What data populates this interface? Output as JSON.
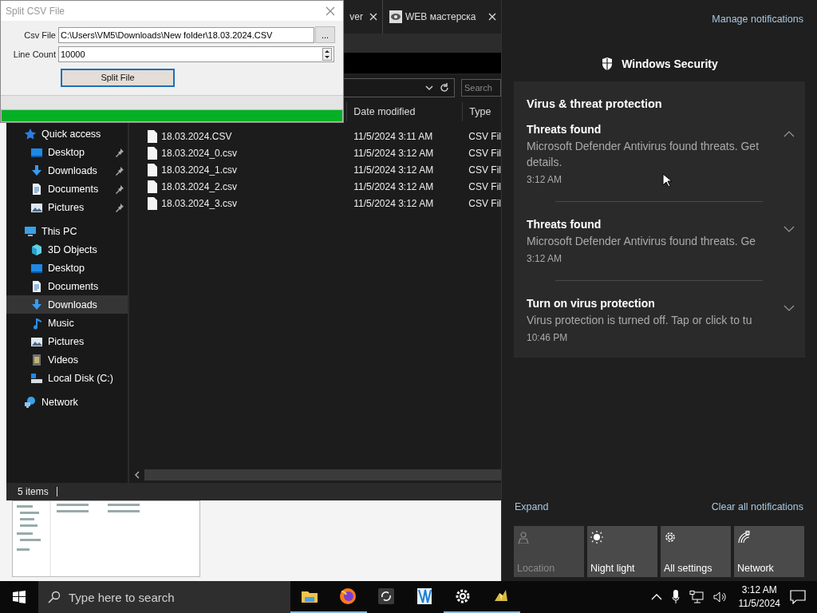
{
  "browser_tabs": [
    {
      "label": "ver",
      "favicon": false
    },
    {
      "label": "WEB мастерска",
      "favicon": true
    }
  ],
  "split_window": {
    "title": "Split CSV File",
    "csv_label": "Csv File",
    "csv_value": "C:\\Users\\VM5\\Downloads\\New folder\\18.03.2024.CSV",
    "browse_button": "...",
    "count_label": "Line Count",
    "count_value": "10000",
    "split_button": "Split File",
    "progress": {
      "level": 1
    }
  },
  "explorer": {
    "search": {
      "placeholder": "Search"
    },
    "sidebar": {
      "items": [
        {
          "label": "Quick access",
          "kind": "star",
          "selected": false,
          "children": [
            {
              "label": "Desktop",
              "kind": "desktop",
              "pinned": true,
              "selected": false
            },
            {
              "label": "Downloads",
              "kind": "download",
              "pinned": true,
              "selected": false
            },
            {
              "label": "Documents",
              "kind": "document",
              "pinned": true,
              "selected": false
            },
            {
              "label": "Pictures",
              "kind": "pictures",
              "pinned": true,
              "selected": false
            }
          ]
        },
        {
          "label": "This PC",
          "kind": "pc",
          "selected": false,
          "children": [
            {
              "label": "3D Objects",
              "kind": "cube",
              "selected": false
            },
            {
              "label": "Desktop",
              "kind": "desktop",
              "selected": false
            },
            {
              "label": "Documents",
              "kind": "document",
              "selected": false
            },
            {
              "label": "Downloads",
              "kind": "download",
              "selected": true
            },
            {
              "label": "Music",
              "kind": "music",
              "selected": false
            },
            {
              "label": "Pictures",
              "kind": "pictures",
              "selected": false
            },
            {
              "label": "Videos",
              "kind": "video",
              "selected": false
            },
            {
              "label": "Local Disk (C:)",
              "kind": "disk",
              "selected": false
            }
          ]
        },
        {
          "label": "Network",
          "kind": "network",
          "selected": false
        }
      ]
    },
    "columns": [
      "Date modified",
      "Type"
    ],
    "files": [
      {
        "name": "18.03.2024.CSV",
        "date": "11/5/2024 3:11 AM",
        "type": "CSV Fil"
      },
      {
        "name": "18.03.2024_0.csv",
        "date": "11/5/2024 3:12 AM",
        "type": "CSV Fil"
      },
      {
        "name": "18.03.2024_1.csv",
        "date": "11/5/2024 3:12 AM",
        "type": "CSV Fil"
      },
      {
        "name": "18.03.2024_2.csv",
        "date": "11/5/2024 3:12 AM",
        "type": "CSV Fil"
      },
      {
        "name": "18.03.2024_3.csv",
        "date": "11/5/2024 3:12 AM",
        "type": "CSV Fil"
      }
    ],
    "status_bar": "5 items"
  },
  "action_center": {
    "manage_link": "Manage notifications",
    "app_name": "Windows Security",
    "group_title": "Virus & threat protection",
    "notifications": [
      {
        "title": "Threats found",
        "body": "Microsoft Defender Antivirus found threats. Get details.",
        "time": "3:12 AM",
        "expanded": true
      },
      {
        "title": "Threats found",
        "body": "Microsoft Defender Antivirus found threats. Ge",
        "time": "3:12 AM",
        "expanded": false
      },
      {
        "title": "Turn on virus protection",
        "body": "Virus protection is turned off. Tap or click to tu",
        "time": "10:46 PM",
        "expanded": false
      }
    ],
    "expand_link": "Expand",
    "clear_link": "Clear all notifications",
    "quick_actions": [
      {
        "label": "Location",
        "kind": "location",
        "disabled": true
      },
      {
        "label": "Night light",
        "kind": "nightlight",
        "disabled": false
      },
      {
        "label": "All settings",
        "kind": "settings",
        "disabled": false
      },
      {
        "label": "Network",
        "kind": "network",
        "disabled": false
      }
    ]
  },
  "taskbar": {
    "search": {
      "placeholder": "Type here to search"
    },
    "apps": [
      {
        "kind": "folder",
        "running": true
      },
      {
        "kind": "firefox",
        "running": true
      },
      {
        "kind": "sync",
        "running": false
      },
      {
        "kind": "film",
        "running": false
      },
      {
        "kind": "gear",
        "running": true
      },
      {
        "kind": "gem",
        "running": true
      }
    ],
    "time": "3:12 AM",
    "date": "11/5/2024"
  }
}
